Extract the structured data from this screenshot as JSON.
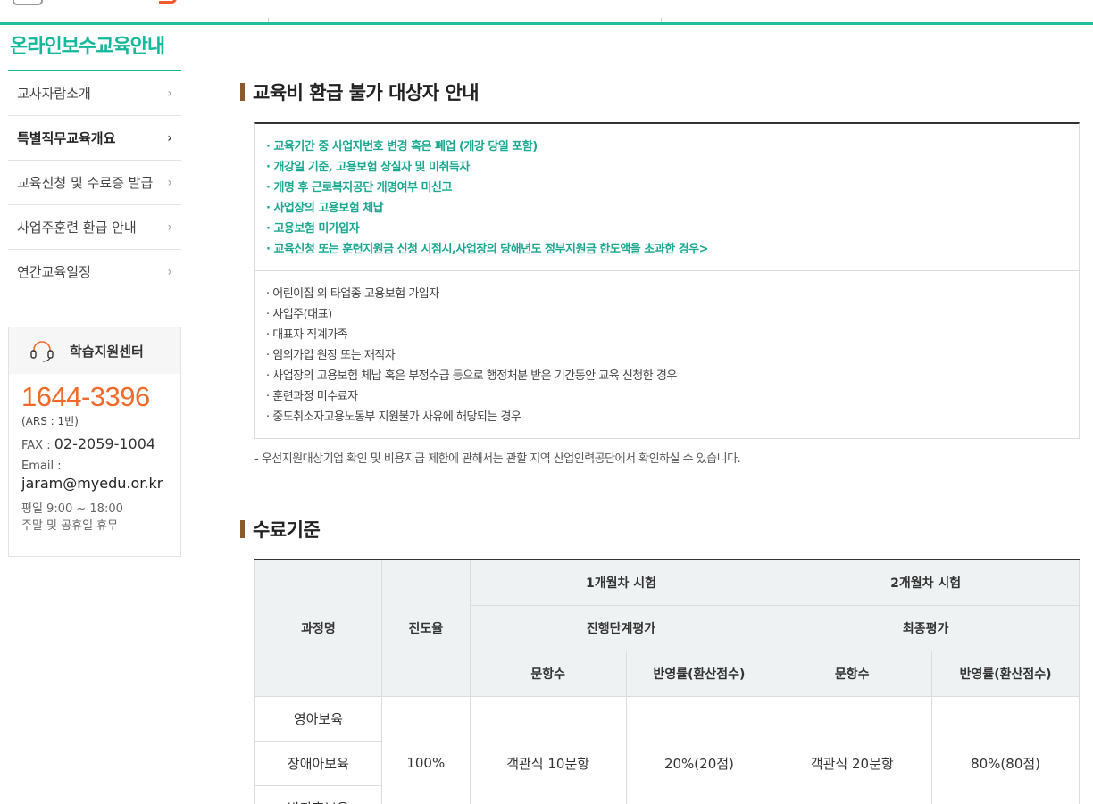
{
  "sidebar": {
    "title": "온라인보수교육안내",
    "items": [
      {
        "label": "교사자람소개",
        "active": false
      },
      {
        "label": "특별직무교육개요",
        "active": true
      },
      {
        "label": "교육신청 및 수료증 발급",
        "active": false
      },
      {
        "label": "사업주훈련 환급 안내",
        "active": false
      },
      {
        "label": "연간교육일정",
        "active": false
      }
    ],
    "support": {
      "title": "학습지원센터",
      "phone": "1644-3396",
      "ars": "(ARS : 1번)",
      "fax_label": "FAX : ",
      "fax_value": "02-2059-1004",
      "email_label": "Email :",
      "email_value": "jaram@myedu.or.kr",
      "hours_weekday": "평일 9:00 ~ 18:00",
      "hours_weekend": "주말 및 공휴일 휴무"
    }
  },
  "refund_section": {
    "title": "교육비 환급 불가 대상자 안내",
    "highlight_items": [
      "· 교육기간 중 사업자번호 변경 혹은 폐업 (개강 당일 포함)",
      "· 개강일 기준, 고용보험 상실자 및 미취득자",
      "· 개명 후 근로복지공단 개명여부 미신고",
      "· 사업장의 고용보험 체납",
      "· 고용보험 미가입자",
      "· 교육신청 또는 훈련지원금 신청 시점시,사업장의 당해년도 정부지원금 한도액을 초과한 경우>"
    ],
    "normal_items": [
      "· 어린이집 외 타업종 고용보험 가입자",
      "· 사업주(대표)",
      "· 대표자 직계가족",
      "· 임의가입 원장 또는 재직자",
      "· 사업장의 고용보험 체납 혹은 부정수급 등으로 행정처분 받은 기간동안 교육 신청한 경우",
      "· 훈련과정 미수료자",
      "· 중도취소자고용노동부 지원불가 사유에 해당되는 경우"
    ],
    "note": "- 우선지원대상기업 확인 및 비용지급 제한에 관해서는 관할 지역 산업인력공단에서 확인하실 수 있습니다."
  },
  "completion_section": {
    "title": "수료기준",
    "headers": {
      "course": "과정명",
      "progress": "진도율",
      "month1": "1개월차 시험",
      "month2": "2개월차 시험",
      "eval1": "진행단계평가",
      "eval2": "최종평가",
      "q_count": "문항수",
      "weight": "반영률(환산점수)"
    },
    "courses": [
      "영아보육",
      "장애아보육",
      "방과후보육"
    ],
    "progress_value": "100%",
    "month1_questions": "객관식 10문항",
    "month1_weight": "20%(20점)",
    "month2_questions": "객관식 20문항",
    "month2_weight": "80%(80점)"
  }
}
